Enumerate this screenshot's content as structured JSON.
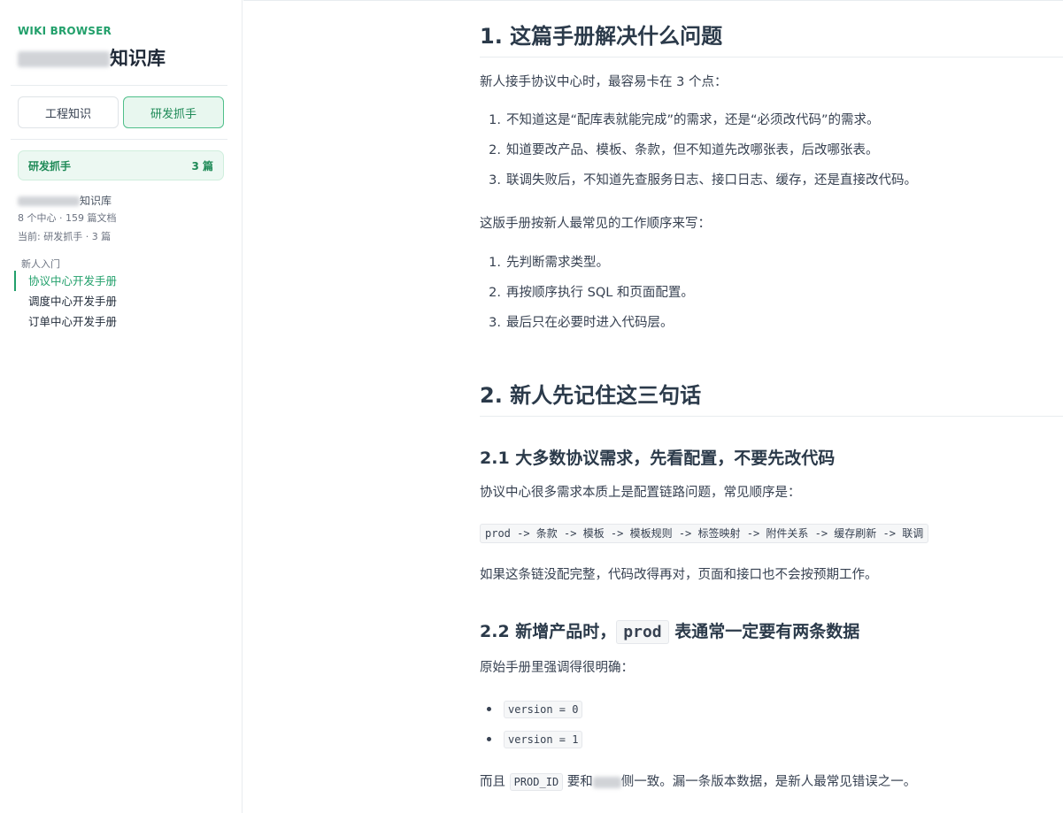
{
  "sidebar": {
    "brand": "WIKI BROWSER",
    "title_suffix": "知识库",
    "tabs": [
      {
        "label": "工程知识",
        "active": false
      },
      {
        "label": "研发抓手",
        "active": true
      }
    ],
    "section": {
      "name": "研发抓手",
      "count": "3 篇"
    },
    "kb_name_suffix": "知识库",
    "kb_stats": "8 个中心 · 159 篇文档",
    "current": "当前: 研发抓手 · 3 篇",
    "group_label": "新人入门",
    "nav_items": [
      {
        "label": "协议中心开发手册",
        "active": true
      },
      {
        "label": "调度中心开发手册",
        "active": false
      },
      {
        "label": "订单中心开发手册",
        "active": false
      }
    ]
  },
  "article": {
    "s1_title": "1. 这篇手册解决什么问题",
    "s1_intro": "新人接手协议中心时，最容易卡在 3 个点：",
    "s1_points": [
      {
        "num": "1.",
        "text": "不知道这是“配库表就能完成”的需求，还是“必须改代码”的需求。"
      },
      {
        "num": "2.",
        "text": "知道要改产品、模板、条款，但不知道先改哪张表，后改哪张表。"
      },
      {
        "num": "3.",
        "text": "联调失败后，不知道先查服务日志、接口日志、缓存，还是直接改代码。"
      }
    ],
    "s1_order_intro": "这版手册按新人最常见的工作顺序来写：",
    "s1_steps": [
      {
        "num": "1.",
        "text": "先判断需求类型。"
      },
      {
        "num": "2.",
        "text": "再按顺序执行 SQL 和页面配置。"
      },
      {
        "num": "3.",
        "text": "最后只在必要时进入代码层。"
      }
    ],
    "s2_title": "2. 新人先记住这三句话",
    "s21_title": "2.1 大多数协议需求，先看配置，不要先改代码",
    "s21_text": "协议中心很多需求本质上是配置链路问题，常见顺序是：",
    "s21_code": "prod -> 条款 -> 模板 -> 模板规则 -> 标签映射 -> 附件关系 -> 缓存刷新 -> 联调",
    "s21_after": "如果这条链没配完整，代码改得再对，页面和接口也不会按预期工作。",
    "s22_title_pre": "2.2 新增产品时，",
    "s22_title_code": "prod",
    "s22_title_post": "表通常一定要有两条数据",
    "s22_text": "原始手册里强调得很明确：",
    "s22_bullets": [
      "version = 0",
      "version = 1"
    ],
    "s22_last_pre": "而且",
    "s22_last_code": "PROD_ID",
    "s22_last_mid": "要和",
    "s22_last_post": "侧一致。漏一条版本数据，是新人最常见错误之一。"
  }
}
